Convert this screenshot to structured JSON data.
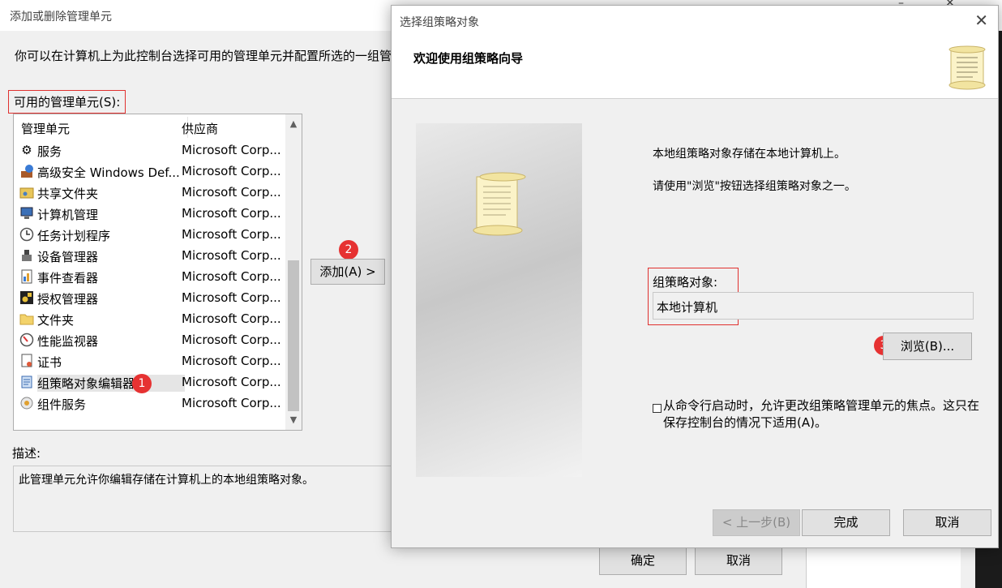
{
  "back_window": {
    "title": "添加或删除管理单元",
    "minimize_glyph": "–",
    "close_glyph": "✕",
    "intro": "你可以在计算机上为此控制台选择可用的管理单元并配置所选的一组管",
    "available_label": "可用的管理单元(S):",
    "list": {
      "col_name": "管理单元",
      "col_vendor": "供应商",
      "items": [
        {
          "name": "服务",
          "vendor": "Microsoft Corp...",
          "icon": "gear-icon"
        },
        {
          "name": "高级安全 Windows Def...",
          "vendor": "Microsoft Corp...",
          "icon": "firewall-icon"
        },
        {
          "name": "共享文件夹",
          "vendor": "Microsoft Corp...",
          "icon": "shared-folder-icon"
        },
        {
          "name": "计算机管理",
          "vendor": "Microsoft Corp...",
          "icon": "computer-management-icon"
        },
        {
          "name": "任务计划程序",
          "vendor": "Microsoft Corp...",
          "icon": "clock-icon"
        },
        {
          "name": "设备管理器",
          "vendor": "Microsoft Corp...",
          "icon": "device-manager-icon"
        },
        {
          "name": "事件查看器",
          "vendor": "Microsoft Corp...",
          "icon": "event-viewer-icon"
        },
        {
          "name": "授权管理器",
          "vendor": "Microsoft Corp...",
          "icon": "authorization-icon"
        },
        {
          "name": "文件夹",
          "vendor": "Microsoft Corp...",
          "icon": "folder-icon"
        },
        {
          "name": "性能监视器",
          "vendor": "Microsoft Corp...",
          "icon": "performance-monitor-icon"
        },
        {
          "name": "证书",
          "vendor": "Microsoft Corp...",
          "icon": "certificate-icon"
        },
        {
          "name": "组策略对象编辑器",
          "vendor": "Microsoft Corp...",
          "icon": "group-policy-icon"
        },
        {
          "name": "组件服务",
          "vendor": "Microsoft Corp...",
          "icon": "component-services-icon"
        }
      ]
    },
    "add_button": "添加(A) >",
    "description_label": "描述:",
    "description_text": "此管理单元允许你编辑存储在计算机上的本地组策略对象。",
    "ok_button": "确定",
    "cancel_button": "取消"
  },
  "badges": {
    "one": "1",
    "two": "2",
    "three": "3"
  },
  "wizard": {
    "title": "选择组策略对象",
    "close_glyph": "✕",
    "heading": "欢迎使用组策略向导",
    "line1": "本地组策略对象存储在本地计算机上。",
    "line2": "请使用\"浏览\"按钮选择组策略对象之一。",
    "gpo_label": "组策略对象:",
    "gpo_value": "本地计算机",
    "browse_button": "浏览(B)...",
    "checkbox_text": "从命令行启动时，允许更改组策略管理单元的焦点。这只在保存控制台的情况下适用(A)。",
    "back_button": "< 上一步(B)",
    "finish_button": "完成",
    "cancel_button": "取消"
  },
  "colors": {
    "highlight_border": "#e0312f",
    "badge": "#e63232"
  }
}
